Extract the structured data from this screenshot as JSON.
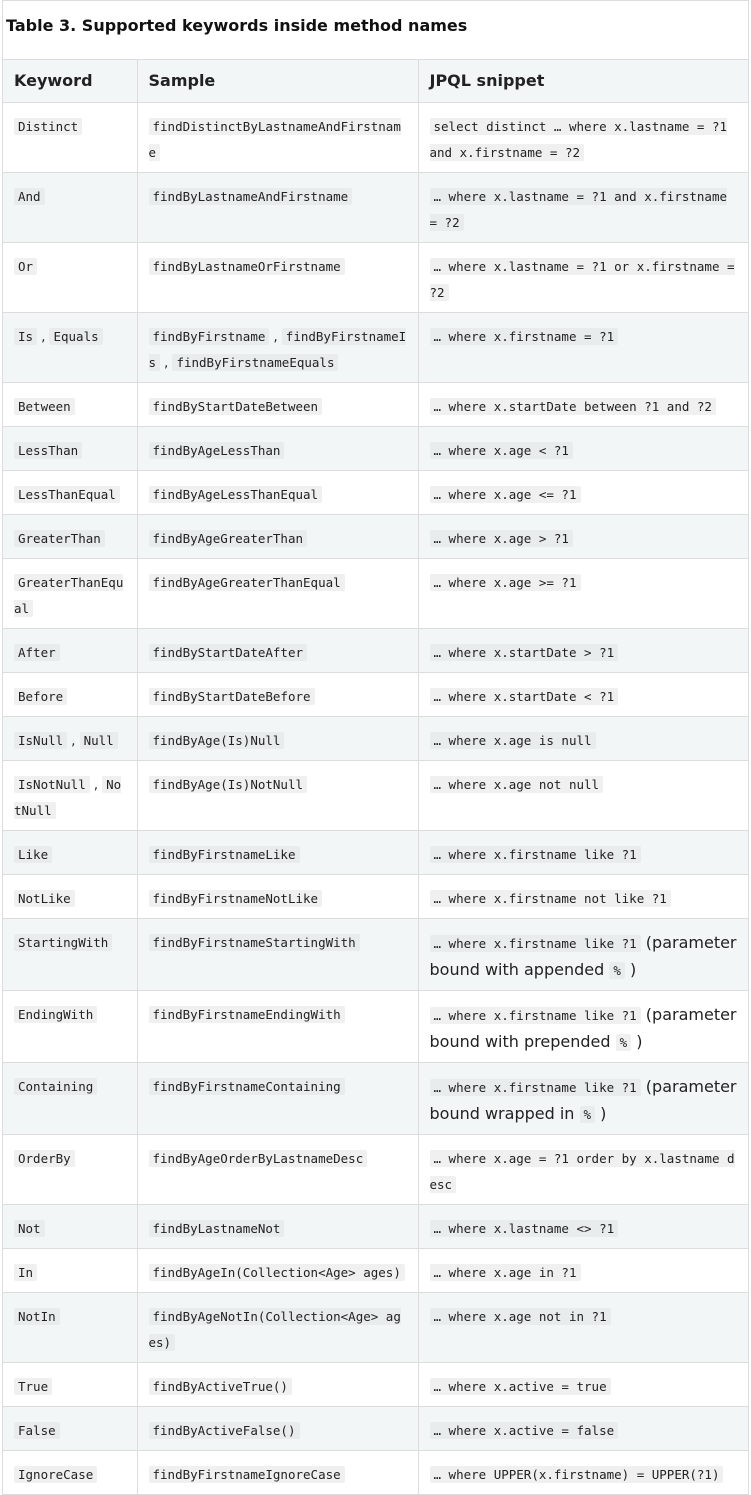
{
  "caption": "Table 3. Supported keywords inside method names",
  "headers": [
    "Keyword",
    "Sample",
    "JPQL snippet"
  ],
  "rows": [
    {
      "keyword": [
        "Distinct"
      ],
      "sample": [
        "findDistinctByLastnameAndFirstname"
      ],
      "jpql": "select distinct … where x.lastname = ?1 and x.firstname = ?2",
      "note_before": "",
      "note_code": "",
      "note_after": ""
    },
    {
      "keyword": [
        "And"
      ],
      "sample": [
        "findByLastnameAndFirstname"
      ],
      "jpql": "… where x.lastname = ?1 and x.firstname = ?2",
      "note_before": "",
      "note_code": "",
      "note_after": ""
    },
    {
      "keyword": [
        "Or"
      ],
      "sample": [
        "findByLastnameOrFirstname"
      ],
      "jpql": "… where x.lastname = ?1 or x.firstname = ?2",
      "note_before": "",
      "note_code": "",
      "note_after": ""
    },
    {
      "keyword": [
        "Is",
        "Equals"
      ],
      "sample": [
        "findByFirstname",
        "findByFirstnameIs",
        "findByFirstnameEquals"
      ],
      "jpql": "… where x.firstname = ?1",
      "note_before": "",
      "note_code": "",
      "note_after": ""
    },
    {
      "keyword": [
        "Between"
      ],
      "sample": [
        "findByStartDateBetween"
      ],
      "jpql": "… where x.startDate between ?1 and ?2",
      "note_before": "",
      "note_code": "",
      "note_after": ""
    },
    {
      "keyword": [
        "LessThan"
      ],
      "sample": [
        "findByAgeLessThan"
      ],
      "jpql": "… where x.age < ?1",
      "note_before": "",
      "note_code": "",
      "note_after": ""
    },
    {
      "keyword": [
        "LessThanEqual"
      ],
      "sample": [
        "findByAgeLessThanEqual"
      ],
      "jpql": "… where x.age <= ?1",
      "note_before": "",
      "note_code": "",
      "note_after": ""
    },
    {
      "keyword": [
        "GreaterThan"
      ],
      "sample": [
        "findByAgeGreaterThan"
      ],
      "jpql": "… where x.age > ?1",
      "note_before": "",
      "note_code": "",
      "note_after": ""
    },
    {
      "keyword": [
        "GreaterThanEqual"
      ],
      "sample": [
        "findByAgeGreaterThanEqual"
      ],
      "jpql": "… where x.age >= ?1",
      "note_before": "",
      "note_code": "",
      "note_after": ""
    },
    {
      "keyword": [
        "After"
      ],
      "sample": [
        "findByStartDateAfter"
      ],
      "jpql": "… where x.startDate > ?1",
      "note_before": "",
      "note_code": "",
      "note_after": ""
    },
    {
      "keyword": [
        "Before"
      ],
      "sample": [
        "findByStartDateBefore"
      ],
      "jpql": "… where x.startDate < ?1",
      "note_before": "",
      "note_code": "",
      "note_after": ""
    },
    {
      "keyword": [
        "IsNull",
        "Null"
      ],
      "sample": [
        "findByAge(Is)Null"
      ],
      "jpql": "… where x.age is null",
      "note_before": "",
      "note_code": "",
      "note_after": ""
    },
    {
      "keyword": [
        "IsNotNull",
        "NotNull"
      ],
      "sample": [
        "findByAge(Is)NotNull"
      ],
      "jpql": "… where x.age not null",
      "note_before": "",
      "note_code": "",
      "note_after": ""
    },
    {
      "keyword": [
        "Like"
      ],
      "sample": [
        "findByFirstnameLike"
      ],
      "jpql": "… where x.firstname like ?1",
      "note_before": "",
      "note_code": "",
      "note_after": ""
    },
    {
      "keyword": [
        "NotLike"
      ],
      "sample": [
        "findByFirstnameNotLike"
      ],
      "jpql": "… where x.firstname not like ?1",
      "note_before": "",
      "note_code": "",
      "note_after": ""
    },
    {
      "keyword": [
        "StartingWith"
      ],
      "sample": [
        "findByFirstnameStartingWith"
      ],
      "jpql": "… where x.firstname like ?1",
      "note_before": "(parameter bound with appended",
      "note_code": "%",
      "note_after": ")"
    },
    {
      "keyword": [
        "EndingWith"
      ],
      "sample": [
        "findByFirstnameEndingWith"
      ],
      "jpql": "… where x.firstname like ?1",
      "note_before": "(parameter bound with prepended",
      "note_code": "%",
      "note_after": ")"
    },
    {
      "keyword": [
        "Containing"
      ],
      "sample": [
        "findByFirstnameContaining"
      ],
      "jpql": "… where x.firstname like ?1",
      "note_before": "(parameter bound wrapped in",
      "note_code": "%",
      "note_after": ")"
    },
    {
      "keyword": [
        "OrderBy"
      ],
      "sample": [
        "findByAgeOrderByLastnameDesc"
      ],
      "jpql": "… where x.age = ?1 order by x.lastname desc",
      "note_before": "",
      "note_code": "",
      "note_after": ""
    },
    {
      "keyword": [
        "Not"
      ],
      "sample": [
        "findByLastnameNot"
      ],
      "jpql": "… where x.lastname <> ?1",
      "note_before": "",
      "note_code": "",
      "note_after": ""
    },
    {
      "keyword": [
        "In"
      ],
      "sample": [
        "findByAgeIn(Collection<Age> ages)"
      ],
      "jpql": "… where x.age in ?1",
      "note_before": "",
      "note_code": "",
      "note_after": ""
    },
    {
      "keyword": [
        "NotIn"
      ],
      "sample": [
        "findByAgeNotIn(Collection<Age> ages)"
      ],
      "jpql": "… where x.age not in ?1",
      "note_before": "",
      "note_code": "",
      "note_after": ""
    },
    {
      "keyword": [
        "True"
      ],
      "sample": [
        "findByActiveTrue()"
      ],
      "jpql": "… where x.active = true",
      "note_before": "",
      "note_code": "",
      "note_after": ""
    },
    {
      "keyword": [
        "False"
      ],
      "sample": [
        "findByActiveFalse()"
      ],
      "jpql": "… where x.active = false",
      "note_before": "",
      "note_code": "",
      "note_after": ""
    },
    {
      "keyword": [
        "IgnoreCase"
      ],
      "sample": [
        "findByFirstnameIgnoreCase"
      ],
      "jpql": "… where UPPER(x.firstname) = UPPER(?1)",
      "note_before": "",
      "note_code": "",
      "note_after": ""
    }
  ]
}
